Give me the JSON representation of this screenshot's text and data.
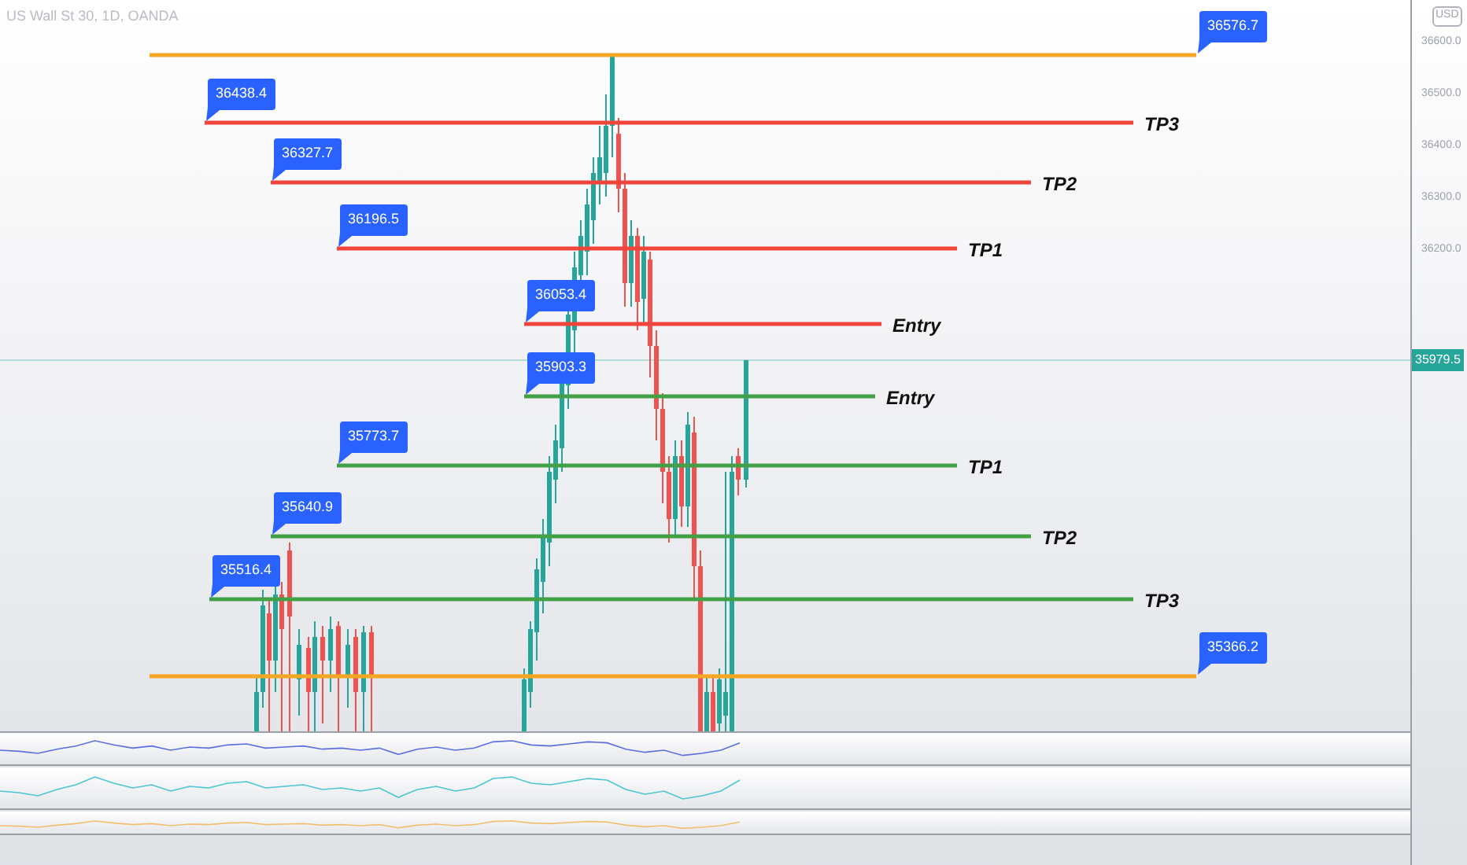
{
  "chart_header": {
    "symbol_title": "US Wall St 30, 1D, OANDA"
  },
  "price_axis": {
    "currency": "USD",
    "ticks": [
      "36600.0",
      "36500.0",
      "36400.0",
      "36300.0",
      "36200.0"
    ],
    "current_price": "35979.5"
  },
  "levels": [
    {
      "price": "36576.7",
      "color": "#f5a623"
    },
    {
      "price": "36438.4",
      "label": "TP3",
      "color": "#f0453a"
    },
    {
      "price": "36327.7",
      "label": "TP2",
      "color": "#f0453a"
    },
    {
      "price": "36196.5",
      "label": "TP1",
      "color": "#f0453a"
    },
    {
      "price": "36053.4",
      "label": "Entry",
      "color": "#f0453a"
    },
    {
      "price": "35903.3",
      "label": "Entry",
      "color": "#43a047"
    },
    {
      "price": "35773.7",
      "label": "TP1",
      "color": "#43a047"
    },
    {
      "price": "35640.9",
      "label": "TP2",
      "color": "#43a047"
    },
    {
      "price": "35516.4",
      "label": "TP3",
      "color": "#43a047"
    },
    {
      "price": "35366.2",
      "color": "#f5a623"
    }
  ]
}
